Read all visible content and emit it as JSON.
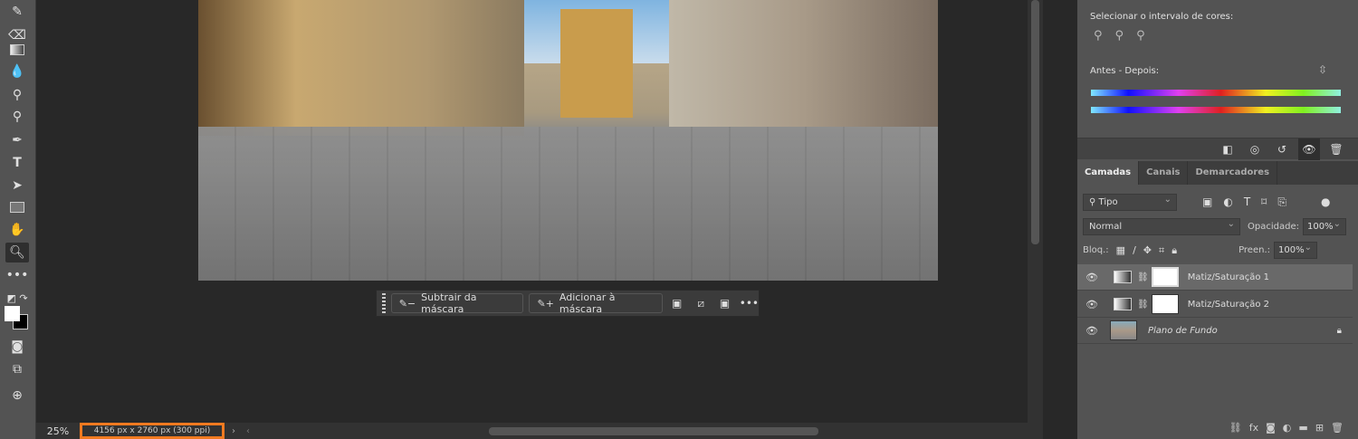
{
  "toolbar": {
    "tools": [
      "brush",
      "eraser",
      "gradient",
      "blur",
      "dodge",
      "burn",
      "pen",
      "type",
      "path-select",
      "rectangle",
      "hand",
      "zoom",
      "more",
      "swap-colors",
      "quick-mask",
      "screen-mode",
      "generative"
    ],
    "active": "zoom",
    "type_glyph": "T"
  },
  "context_bar": {
    "subtract_label": "Subtrair da máscara",
    "add_label": "Adicionar à máscara",
    "more": "•••"
  },
  "status": {
    "zoom": "25%",
    "doc_info": "4156 px x 2760 px (300 ppi)",
    "arrow": "›",
    "left_arrow": "‹"
  },
  "properties": {
    "color_range_label": "Selecionar o intervalo de cores:",
    "before_after_label": "Antes - Depois:"
  },
  "layers_panel": {
    "tabs": [
      "Camadas",
      "Canais",
      "Demarcadores"
    ],
    "active_tab": "Camadas",
    "filter": "Tipo",
    "blend_mode": "Normal",
    "opacity_label": "Opacidade:",
    "opacity": "100%",
    "lock_label": "Bloq.:",
    "fill_label": "Preen.:",
    "fill": "100%",
    "layers": [
      {
        "name": "Matiz/Saturação 1",
        "selected": true
      },
      {
        "name": "Matiz/Saturação 2",
        "selected": false
      },
      {
        "name": "Plano de Fundo",
        "locked": true
      }
    ]
  },
  "colors": {
    "accent_highlight": "#f07a20"
  }
}
